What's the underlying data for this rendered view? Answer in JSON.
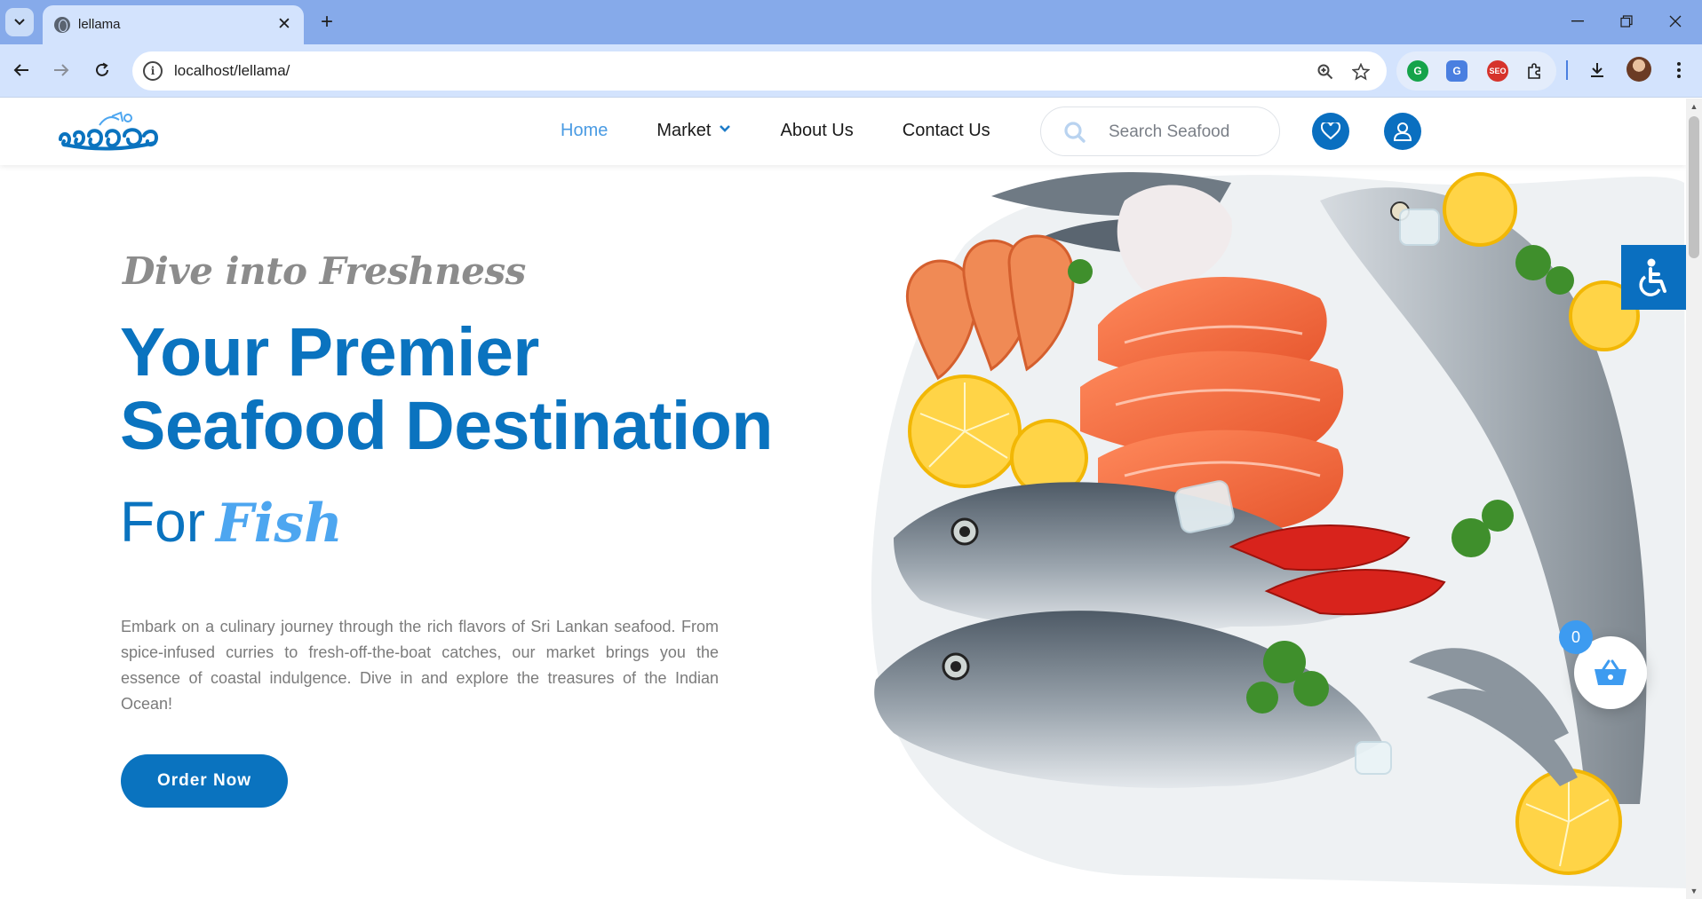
{
  "browser": {
    "tab_title": "lellama",
    "url": "localhost/lellama/",
    "new_tab_symbol": "+",
    "close_symbol": "✕"
  },
  "site": {
    "nav": [
      {
        "label": "Home",
        "active": true
      },
      {
        "label": "Market",
        "active": false,
        "has_dropdown": true
      },
      {
        "label": "About Us",
        "active": false
      },
      {
        "label": "Contact Us",
        "active": false
      }
    ],
    "search_placeholder": "Search Seafood"
  },
  "hero": {
    "tagline": "Dive into Freshness",
    "headline_line1": "Your Premier",
    "headline_line2": "Seafood Destination",
    "for_text": "For",
    "for_highlight": "Fish",
    "description": "Embark on a culinary journey through the rich flavors of Sri Lankan seafood. From spice-infused curries to fresh-off-the-boat catches, our market brings you the essence of coastal indulgence. Dive in and explore the treasures of the Indian Ocean!",
    "cta_label": "Order Now"
  },
  "cart": {
    "count": "0"
  },
  "colors": {
    "brand_blue": "#0a73bf",
    "accent_light_blue": "#4da6f0",
    "chrome_tab_bg": "#86aaea",
    "chrome_toolbar_bg": "#d3e3fd"
  }
}
